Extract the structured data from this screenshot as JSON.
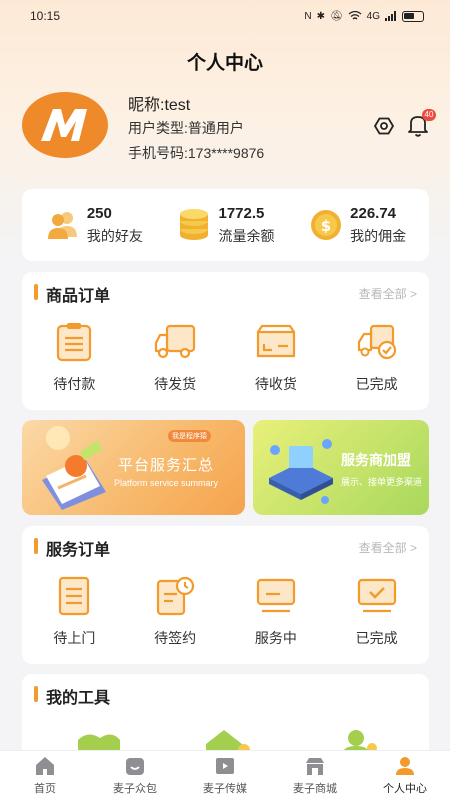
{
  "status_bar": {
    "time": "10:15",
    "network": "4G"
  },
  "header": {
    "title": "个人中心"
  },
  "profile": {
    "nickname": "昵称:test",
    "user_type": "用户类型:普通用户",
    "phone": "手机号码:173****9876",
    "notification_count": "40"
  },
  "stats": [
    {
      "value": "250",
      "label": "我的好友",
      "icon": "friends-icon"
    },
    {
      "value": "1772.5",
      "label": "流量余额",
      "icon": "coins-icon"
    },
    {
      "value": "226.74",
      "label": "我的佣金",
      "icon": "dollar-coin-icon"
    }
  ],
  "goods_orders": {
    "title": "商品订单",
    "more": "查看全部 >",
    "items": [
      {
        "label": "待付款",
        "icon": "clipboard-icon"
      },
      {
        "label": "待发货",
        "icon": "truck-icon"
      },
      {
        "label": "待收货",
        "icon": "package-icon"
      },
      {
        "label": "已完成",
        "icon": "truck-check-icon"
      }
    ]
  },
  "banners": {
    "left": {
      "tag": "我是程序猿",
      "title": "平台服务汇总",
      "subtitle": "Platform service summary"
    },
    "right": {
      "title": "服务商加盟",
      "subtitle": "展示、接单更多渠道"
    }
  },
  "service_orders": {
    "title": "服务订单",
    "more": "查看全部 >",
    "items": [
      {
        "label": "待上门",
        "icon": "document-list-icon"
      },
      {
        "label": "待签约",
        "icon": "document-clock-icon"
      },
      {
        "label": "服务中",
        "icon": "monitor-icon"
      },
      {
        "label": "已完成",
        "icon": "monitor-check-icon"
      }
    ]
  },
  "tools": {
    "title": "我的工具"
  },
  "tabbar": [
    {
      "label": "首页",
      "icon": "home-icon",
      "active": false
    },
    {
      "label": "麦子众包",
      "icon": "smile-bag-icon",
      "active": false
    },
    {
      "label": "麦子传媒",
      "icon": "video-icon",
      "active": false
    },
    {
      "label": "麦子商城",
      "icon": "shop-icon",
      "active": false
    },
    {
      "label": "个人中心",
      "icon": "person-icon",
      "active": true
    }
  ],
  "colors": {
    "accent": "#f39a2c",
    "brand_orange": "#ef8a2b",
    "badge": "#f04a3e"
  }
}
